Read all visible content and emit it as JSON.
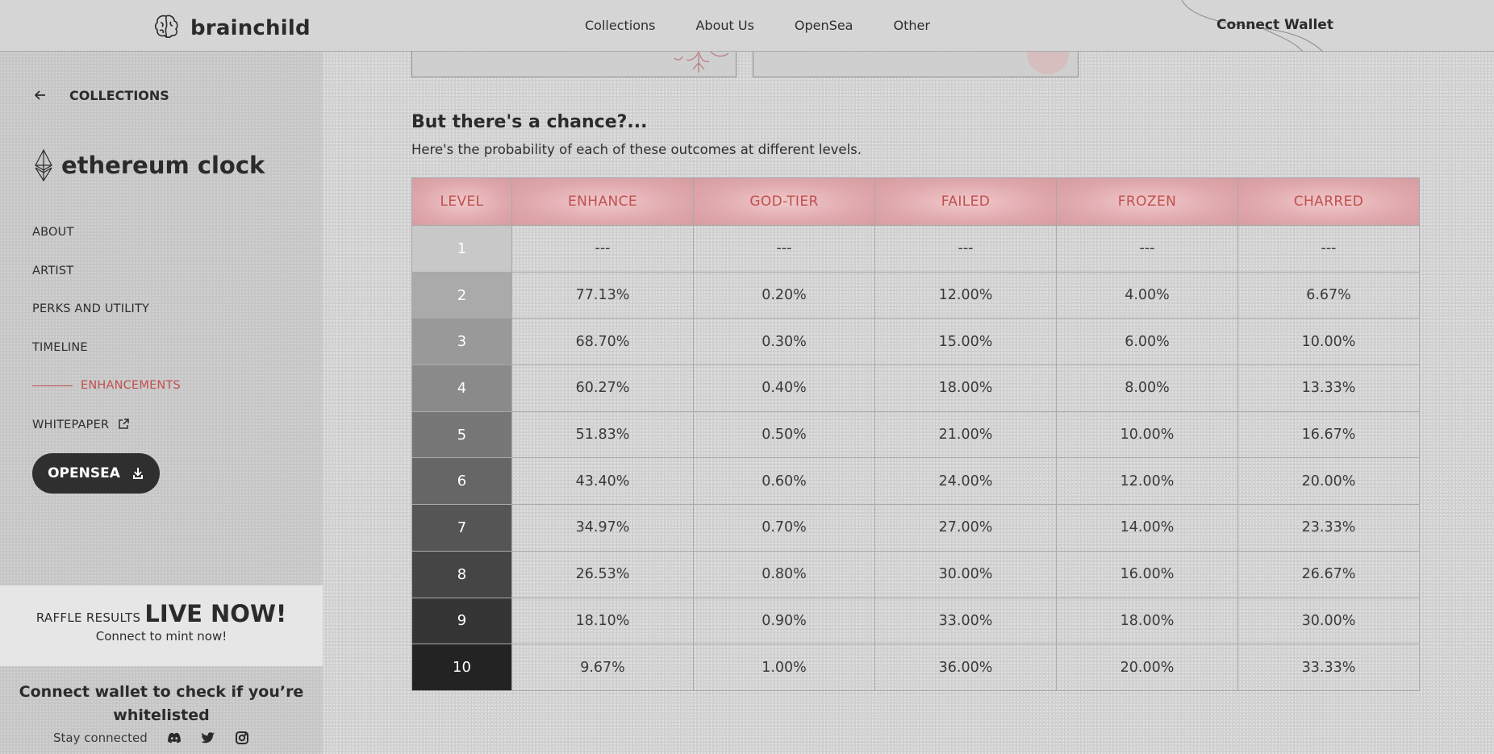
{
  "header": {
    "brand": "brainchild",
    "nav": [
      "Collections",
      "About Us",
      "OpenSea",
      "Other"
    ],
    "connect_wallet": "Connect Wallet"
  },
  "sidebar": {
    "back_label": "COLLECTIONS",
    "collection_title": "ethereum clock",
    "items": [
      "ABOUT",
      "ARTIST",
      "PERKS AND UTILITY",
      "TIMELINE",
      "ENHANCEMENTS",
      "WHITEPAPER"
    ],
    "active_item": "ENHANCEMENTS",
    "opensea_button": "OPENSEA",
    "raffle": {
      "small": "RAFFLE RESULTS",
      "big": "LIVE NOW!",
      "sub": "Connect to mint now!"
    },
    "whitelist_text": "Connect wallet to check if you’re whitelisted",
    "stay_connected": "Stay connected",
    "social_icons": [
      "discord-icon",
      "twitter-icon",
      "instagram-icon"
    ]
  },
  "main": {
    "title": "But there's a chance?...",
    "subtitle": "Here's the probability of each of these outcomes at different levels.",
    "table": {
      "headers": [
        "LEVEL",
        "ENHANCE",
        "GOD-TIER",
        "FAILED",
        "FROZEN",
        "CHARRED"
      ],
      "rows": [
        [
          "1",
          "---",
          "---",
          "---",
          "---",
          "---"
        ],
        [
          "2",
          "77.13%",
          "0.20%",
          "12.00%",
          "4.00%",
          "6.67%"
        ],
        [
          "3",
          "68.70%",
          "0.30%",
          "15.00%",
          "6.00%",
          "10.00%"
        ],
        [
          "4",
          "60.27%",
          "0.40%",
          "18.00%",
          "8.00%",
          "13.33%"
        ],
        [
          "5",
          "51.83%",
          "0.50%",
          "21.00%",
          "10.00%",
          "16.67%"
        ],
        [
          "6",
          "43.40%",
          "0.60%",
          "24.00%",
          "12.00%",
          "20.00%"
        ],
        [
          "7",
          "34.97%",
          "0.70%",
          "27.00%",
          "14.00%",
          "23.33%"
        ],
        [
          "8",
          "26.53%",
          "0.80%",
          "30.00%",
          "16.00%",
          "26.67%"
        ],
        [
          "9",
          "18.10%",
          "0.90%",
          "33.00%",
          "18.00%",
          "30.00%"
        ],
        [
          "10",
          "9.67%",
          "1.00%",
          "36.00%",
          "20.00%",
          "33.33%"
        ]
      ],
      "level_colors": [
        "#c8c8c8",
        "#aaaaaa",
        "#999999",
        "#8a8a8a",
        "#777777",
        "#666666",
        "#555555",
        "#454545",
        "#353535",
        "#232323"
      ]
    }
  },
  "colors": {
    "accent_red": "#c0504d",
    "button_dark": "#2f2f2f"
  }
}
